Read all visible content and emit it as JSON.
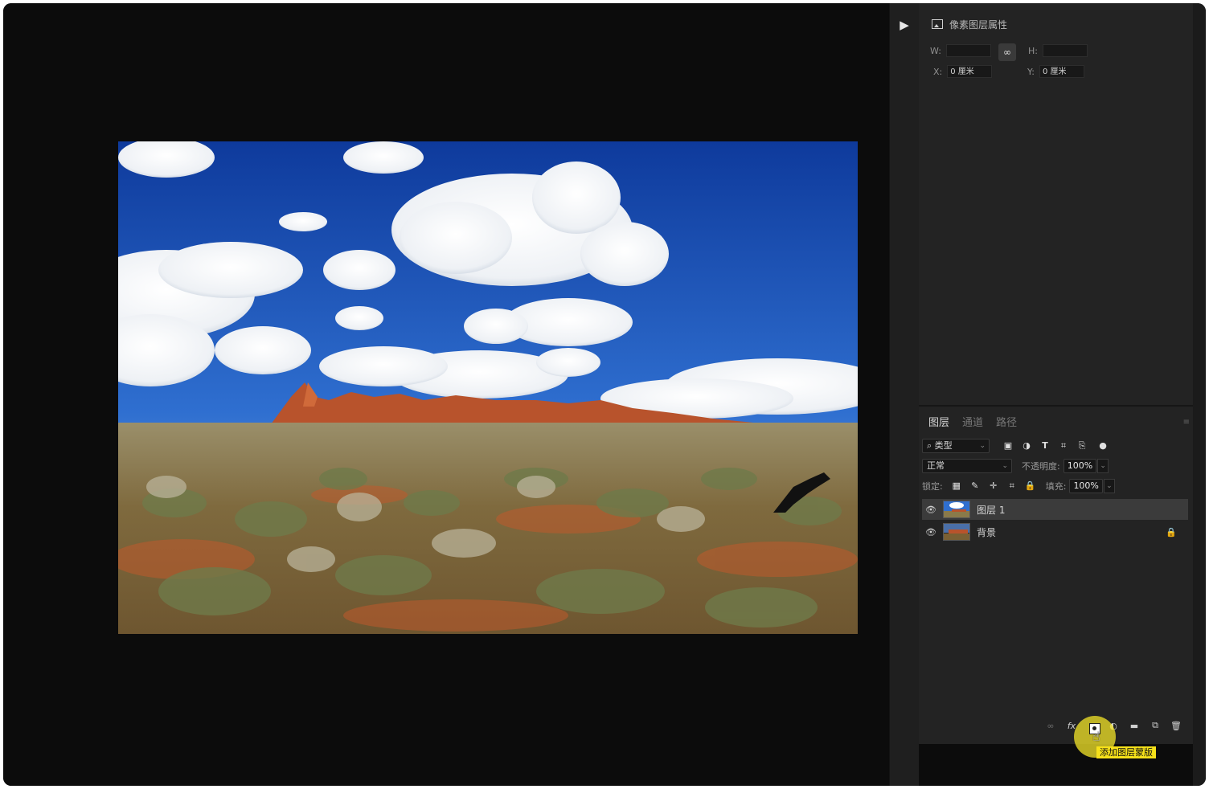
{
  "properties": {
    "title": "像素图层属性",
    "w_label": "W:",
    "w_value": "",
    "h_label": "H:",
    "h_value": "",
    "x_label": "X:",
    "x_value": "0 厘米",
    "y_label": "Y:",
    "y_value": "0 厘米",
    "link_icon": "link-icon"
  },
  "layers_panel": {
    "tabs": [
      "图层",
      "通道",
      "路径"
    ],
    "active_tab": "图层",
    "filter_kind": "类型",
    "blend_mode": "正常",
    "opacity_label": "不透明度:",
    "opacity_value": "100%",
    "lock_label": "锁定:",
    "fill_label": "填充:",
    "fill_value": "100%",
    "layers": [
      {
        "name": "图层 1",
        "visible": true,
        "selected": true,
        "locked": false
      },
      {
        "name": "背景",
        "visible": true,
        "selected": false,
        "locked": true
      }
    ],
    "footer_tooltip": "添加图层蒙版"
  },
  "colors": {
    "app_bg": "#0c0c0c",
    "panel_bg": "#232323",
    "selected_layer": "#3b3b3b",
    "highlight": "#ecde28"
  }
}
